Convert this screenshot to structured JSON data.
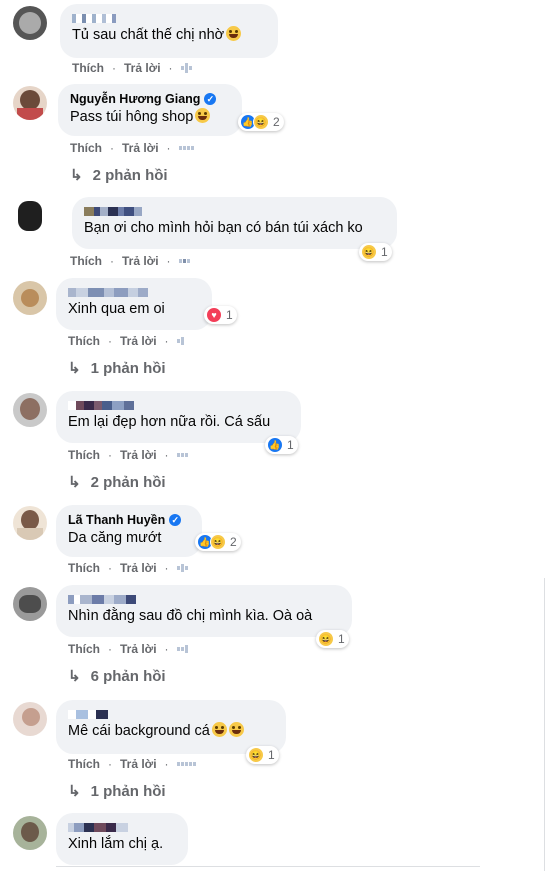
{
  "actions": {
    "like": "Thích",
    "reply": "Trả lời"
  },
  "colors": {
    "bubble": "#f0f2f5",
    "like": "#1877f2",
    "haha": "#f7c948",
    "love": "#f33e58",
    "meta": "#65676b"
  },
  "comments": [
    {
      "author": "",
      "author_hidden": true,
      "text": "Tủ sau chất thế chị nhờ",
      "emoji": [
        "haha-face"
      ],
      "reaction": null,
      "replies": null
    },
    {
      "author": "Nguyễn Hương Giang",
      "verified": true,
      "text": "Pass túi hông shop",
      "emoji": [
        "haha-face"
      ],
      "reaction": {
        "icons": [
          "like",
          "haha"
        ],
        "count": "2"
      },
      "replies": "2 phản hồi"
    },
    {
      "author": "",
      "author_hidden": true,
      "text": "Bạn ơi cho mình hỏi bạn có bán túi xách ko",
      "emoji": [],
      "reaction": {
        "icons": [
          "haha"
        ],
        "count": "1"
      },
      "replies": null
    },
    {
      "author": "",
      "author_hidden": true,
      "text": "Xinh qua em oi",
      "emoji": [],
      "reaction": {
        "icons": [
          "love"
        ],
        "count": "1"
      },
      "replies": "1 phản hồi"
    },
    {
      "author": "",
      "author_hidden": true,
      "text": "Em lại đẹp hơn nữa rồi. Cá sấu",
      "emoji": [],
      "reaction": {
        "icons": [
          "like"
        ],
        "count": "1"
      },
      "replies": "2 phản hồi"
    },
    {
      "author": "Lã Thanh Huyền",
      "verified": true,
      "text": "Da căng mướt",
      "emoji": [],
      "reaction": {
        "icons": [
          "like",
          "haha"
        ],
        "count": "2"
      },
      "replies": null
    },
    {
      "author": "",
      "author_hidden": true,
      "text": "Nhìn đằng sau đồ chị mình kìa. Oà oà",
      "emoji": [],
      "reaction": {
        "icons": [
          "haha"
        ],
        "count": "1"
      },
      "replies": "6 phản hồi"
    },
    {
      "author": "",
      "author_hidden": true,
      "text": "Mê cái background cá",
      "emoji": [
        "haha-face",
        "haha-face"
      ],
      "reaction": {
        "icons": [
          "haha"
        ],
        "count": "1"
      },
      "replies": "1 phản hồi"
    },
    {
      "author": "",
      "author_hidden": true,
      "text": "Xinh lắm chị ạ.",
      "emoji": [],
      "reaction": null,
      "replies": null
    }
  ]
}
